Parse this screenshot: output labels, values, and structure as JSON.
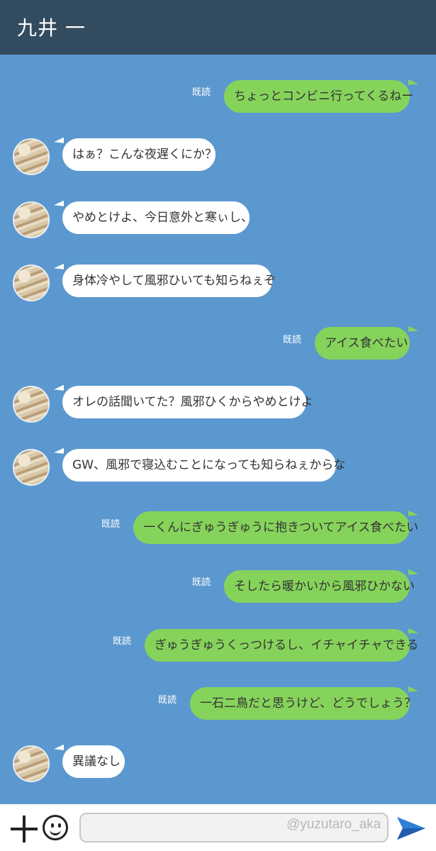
{
  "header": {
    "title": "九井 一"
  },
  "read_label": "既読",
  "messages": [
    {
      "side": "out",
      "text": "ちょっとコンビニ行ってくるねー"
    },
    {
      "side": "in",
      "text": "はぁ？こんな夜遅くにか？"
    },
    {
      "side": "in",
      "text": "やめとけよ、今日意外と寒ぃし、"
    },
    {
      "side": "in",
      "text": "身体冷やして風邪ひいても知らねぇぞ"
    },
    {
      "side": "out",
      "text": "アイス食べたい"
    },
    {
      "side": "in",
      "text": "オレの話聞いてた？風邪ひくからやめとけよ"
    },
    {
      "side": "in",
      "text": "GW、風邪で寝込むことになっても知らねぇからな"
    },
    {
      "side": "out",
      "text": "一くんにぎゅうぎゅうに抱きついてアイス食べたい"
    },
    {
      "side": "out",
      "text": "そしたら暖かいから風邪ひかない"
    },
    {
      "side": "out",
      "text": "ぎゅうぎゅうくっつけるし、イチャイチャできる"
    },
    {
      "side": "out",
      "text": "一石二鳥だと思うけど、どうでしょう？"
    },
    {
      "side": "in",
      "text": "異議なし"
    }
  ],
  "footer": {
    "icons": {
      "attach": "plus-icon",
      "emoji": "smile-icon",
      "send": "send-arrow-icon"
    },
    "watermark": "@yuzutaro_aka"
  }
}
